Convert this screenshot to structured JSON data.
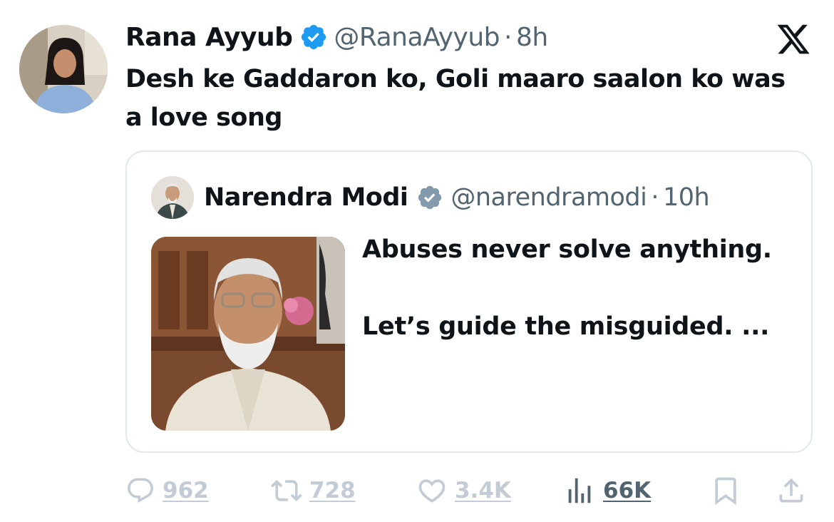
{
  "tweet": {
    "author_name": "Rana Ayyub",
    "handle": "@RanaAyyub",
    "separator": "·",
    "time": "8h",
    "text": "Desh ke Gaddaron ko, Goli maaro saalon ko was a love song",
    "avatar": "woman-portrait-avatar"
  },
  "quote": {
    "author_name": "Narendra Modi",
    "handle": "@narendramodi",
    "separator": "·",
    "time": "10h",
    "text_line1": "Abuses never solve anything.",
    "text_line2": "Let’s guide the misguided. ...",
    "avatar": "man-portrait-avatar",
    "image": "man-portrait-photo"
  },
  "actions": {
    "replies": "962",
    "reposts": "728",
    "likes": "3.4K",
    "views": "66K"
  },
  "colors": {
    "verified": "#1d9bf0",
    "verified_quote": "#829aab",
    "text_primary": "#0f1419",
    "text_secondary": "#536471",
    "action_faded": "#c3ccd4",
    "border": "#e1e8ed"
  },
  "icons": [
    "verified-badge-icon",
    "x-logo-icon",
    "reply-icon",
    "repost-icon",
    "like-icon",
    "views-icon",
    "bookmark-icon",
    "share-icon"
  ]
}
